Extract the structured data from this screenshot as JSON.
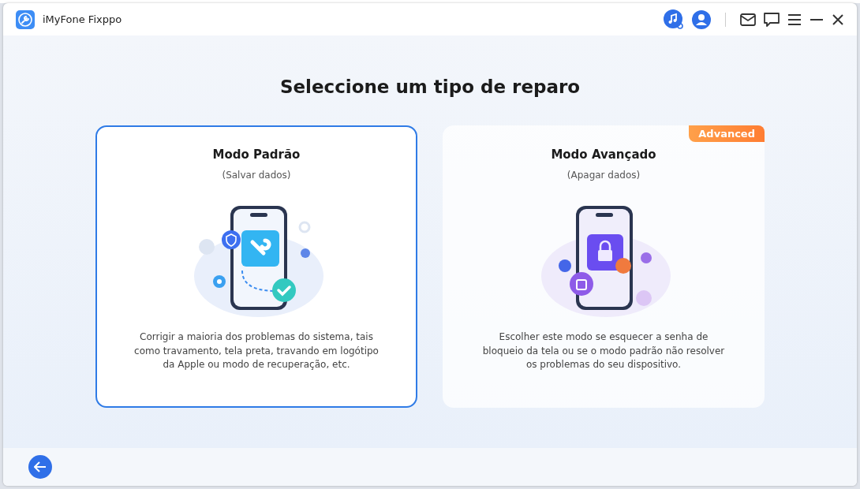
{
  "window": {
    "title": "iMyFone Fixppo"
  },
  "heading": "Seleccione um tipo de reparo",
  "modes": [
    {
      "kind": "repair",
      "title": "Modo Padrão",
      "subtitle": "(Salvar dados)",
      "description": "Corrigir a maioria dos problemas do sistema, tais como travamento, tela preta, travando em logótipo da Apple ou modo de recuperação, etc.",
      "selected": true
    },
    {
      "kind": "erase",
      "title": "Modo Avançado",
      "subtitle": "(Apagar dados)",
      "description": "Escolher este modo se esquecer a senha de bloqueio da tela ou se o modo padrão não resolver os problemas do seu dispositivo.",
      "selected": false,
      "badge": "Advanced"
    }
  ]
}
